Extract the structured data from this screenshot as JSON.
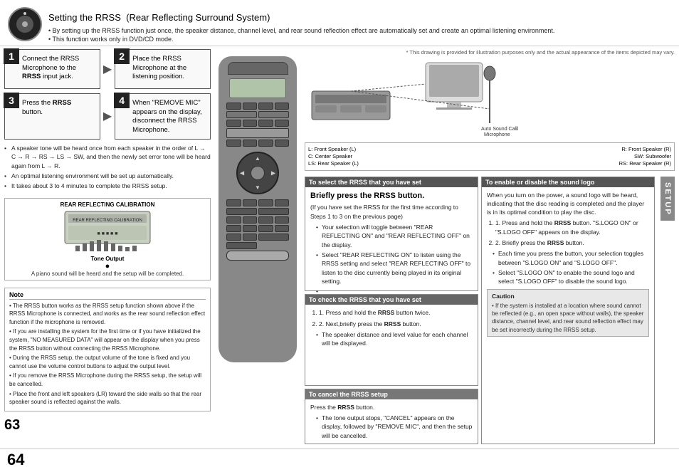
{
  "header": {
    "title_main": "Setting the RRSS",
    "title_sub": "(Rear Reflecting Surround System)",
    "subtitle1": "• By setting up the RRSS function just once, the speaker distance, channel level, and rear sound reflection effect are automatically set and create an optimal listening environment.",
    "subtitle2": "• This function works only in DVD/CD mode."
  },
  "steps": {
    "step1": {
      "number": "1",
      "text_pre": "Connect the RRSS Microphone to the ",
      "text_bold": "RRSS",
      "text_post": " input jack."
    },
    "step2": {
      "number": "2",
      "text": "Place the RRSS Microphone at the listening position."
    },
    "step3": {
      "number": "3",
      "text_pre": "Press the ",
      "text_bold": "RRSS",
      "text_post": "button."
    },
    "step4": {
      "number": "4",
      "text": "When \"REMOVE MIC\" appears on the display, disconnect the RRSS Microphone."
    }
  },
  "left_bullets": {
    "b1": "A speaker tone will be heard once from each speaker in the order of L → C → R → RS → LS → SW, and then the newly set error tone will be heard again from L → R.",
    "b2": "An optimal listening environment will be set up automatically.",
    "b3": "It takes about 3 to 4 minutes to complete the RRSS setup."
  },
  "tone_box": {
    "title": "REAR REFLECTING CALIBRATION",
    "output_label": "Tone Output",
    "description": "A piano sound will be heard and the setup will be completed."
  },
  "note": {
    "title": "Note",
    "p1": "• The RRSS button works as the RRSS setup function shown above if the RRSS Microphone is connected, and works as the rear sound reflection effect function if the microphone is removed.",
    "p2": "• If you are installing the system for the first time or if you have initialized the system, \"NO MEASURED DATA\" will appear on the display when you press the RRSS button without connecting the RRSS Microphone.",
    "p3": "• During the RRSS setup, the output volume of the tone is fixed and you cannot use the volume control buttons to adjust the output level.",
    "p4": "• If you remove the RRSS Microphone during the RRSS setup, the setup will be cancelled.",
    "p5": "• Place the front and left speakers (LR) toward the side walls so that the rear speaker sound is reflected against the walls."
  },
  "page_numbers": {
    "left": "63",
    "right": "64"
  },
  "illustration": {
    "note": "* This drawing is provided for illustration\npurposes only and the actual appearance\nof the items depicted may vary."
  },
  "speaker_diagram": {
    "r1c1": "L: Front Speaker (L)",
    "r1c2": "R: Front Speaker (R)",
    "r2c1": "C: Center Speaker",
    "r2c2": "SW: Subwoofer",
    "r3c1": "LS: Rear Speaker (L)",
    "r3c2": "RS: Rear Speaker (R)"
  },
  "sections": {
    "select_rrss": {
      "header": "To select the RRSS that you have set",
      "briefly": "Briefly press the RRSS button.",
      "sub_note": "(If you have set the RRSS for the first time according to Steps 1 to 3 on the previous page)",
      "bullets": {
        "b1": "Your selection will toggle between \"REAR REFLECTING ON\" and \"REAR REFLECTING OFF\" on the display.",
        "b2": "Select \"REAR REFLECTING ON\" to listen using the RRSS setting and select \"REAR REFLECTING OFF\" to listen to the disc currently being played in its original setting.",
        "b3": ""
      }
    },
    "check_rrss": {
      "header": "To check the RRSS that you have set",
      "step1_pre": "1. Press and hold the ",
      "step1_bold": "RRSS",
      "step1_post": " button twice.",
      "step2_pre": "2. Next,briefly press the ",
      "step2_bold": "RRSS",
      "step2_post": " button.",
      "bullets": {
        "b1": "The speaker distance and level value for each channel will be displayed."
      }
    },
    "cancel_rrss": {
      "header": "To cancel the RRSS setup",
      "press_pre": "Press the ",
      "press_bold": "RRSS",
      "press_post": " button.",
      "bullets": {
        "b1": "The tone output stops, \"CANCEL\" appears on the display, followed by \"REMOVE MIC\", and then the setup will be cancelled."
      }
    },
    "sound_logo": {
      "header": "To enable or disable the sound logo",
      "intro": "When you turn on the power, a sound logo will be heard, indicating that the disc reading is completed and the player is in its optimal condition to play the disc.",
      "step1_pre": "1. Press and hold the ",
      "step1_bold": "RRSS",
      "step1_post": " button. \"S.LOGO ON\" or \"S.LOGO OFF\" appears on the display.",
      "step2_pre": "2. Briefly press the ",
      "step2_bold": "RRSS",
      "step2_post": " button.",
      "bullets": {
        "b1": "Each time you press the button, your selection toggles between \"S.LOGO ON\" and \"S.LOGO OFF\".",
        "b2": "Select \"S.LOGO ON\" to enable the sound logo and select \"S.LOGO OFF\" to disable the sound logo."
      },
      "caution": {
        "title": "Caution",
        "text": "• If the system is installed at a location where sound cannot be reflected (e.g., an open space without walls), the speaker distance, channel level, and rear sound reflection effect may be set incorrectly during the RRSS setup."
      }
    }
  },
  "setup_tab": {
    "label": "SETUP"
  }
}
